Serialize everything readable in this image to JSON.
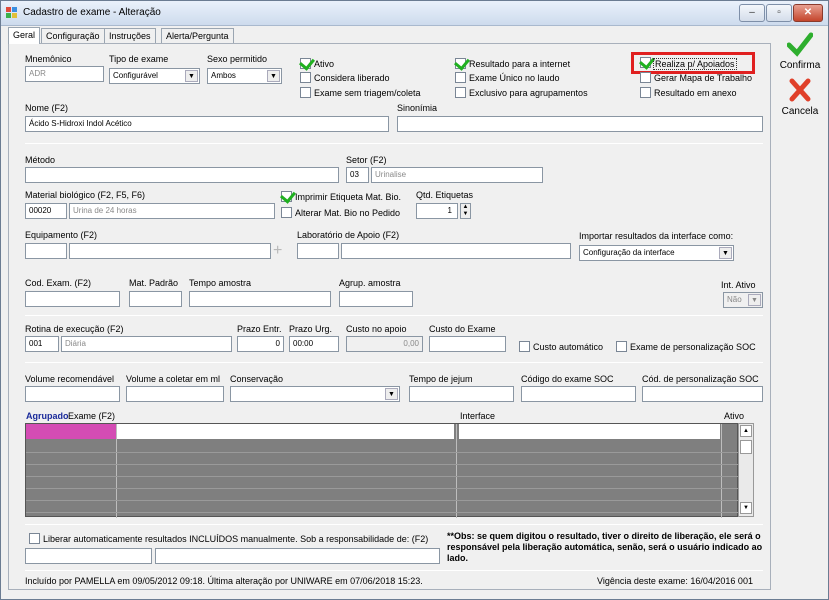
{
  "window": {
    "title": "Cadastro de exame - Alteração",
    "minimize": "–",
    "maximize": "▫",
    "close": "✕"
  },
  "tabs": [
    "Geral",
    "Configuração",
    "Instruções",
    "Alerta/Pergunta"
  ],
  "actions": {
    "confirm": "Confirma",
    "cancel": "Cancela"
  },
  "fields": {
    "mnemonico_label": "Mnemônico",
    "mnemonico_value": "ADR",
    "tipo_label": "Tipo de exame",
    "tipo_value": "Configurável",
    "sexo_label": "Sexo permitido",
    "sexo_value": "Ambos",
    "nome_label": "Nome (F2)",
    "nome_value": "Ácido S-Hidroxi Indol Acético",
    "sinonimia_label": "Sinonímia",
    "metodo_label": "Método",
    "setor_label": "Setor (F2)",
    "setor_code": "03",
    "setor_name": "Urinalise",
    "material_label": "Material biológico (F2, F5, F6)",
    "material_code": "00020",
    "material_name": "Urina de 24 horas",
    "qtd_label": "Qtd. Etiquetas",
    "qtd_value": "1",
    "equip_label": "Equipamento (F2)",
    "lab_label": "Laboratório de Apoio (F2)",
    "importar_label": "Importar resultados da interface como:",
    "importar_value": "Configuração da interface",
    "cod_exam_label": "Cod. Exam. (F2)",
    "mat_padrao_label": "Mat. Padrão",
    "tempo_amostra_label": "Tempo amostra",
    "agrup_amostra_label": "Agrup. amostra",
    "int_ativo_label": "Int. Ativo",
    "int_ativo_value": "Não",
    "rotina_label": "Rotina de execução (F2)",
    "rotina_code": "001",
    "rotina_name": "Diária",
    "prazo_entr_label": "Prazo Entr.",
    "prazo_entr_value": "0",
    "prazo_urg_label": "Prazo Urg.",
    "prazo_urg_value": "00:00",
    "custo_apoio_label": "Custo no apoio",
    "custo_apoio_value": "0,00",
    "custo_exame_label": "Custo do Exame",
    "vol_rec_label": "Volume recomendável",
    "vol_col_label": "Volume a coletar em ml",
    "conservacao_label": "Conservação",
    "jejum_label": "Tempo de jejum",
    "cod_soc_label": "Código do exame SOC",
    "cod_pers_soc_label": "Cód. de personalização SOC"
  },
  "checkboxes": {
    "ativo": "Ativo",
    "considera_liberado": "Considera liberado",
    "sem_triagem": "Exame sem triagem/coleta",
    "resultado_internet": "Resultado para a internet",
    "exame_unico": "Exame Único no laudo",
    "exclusivo_agrup": "Exclusivo para agrupamentos",
    "realiza_apoiados": "Realiza p/ Apoiados",
    "gerar_mapa": "Gerar Mapa de Trabalho",
    "resultado_anexo": "Resultado em anexo",
    "imprimir_etiqueta": "Imprimir Etiqueta Mat. Bio.",
    "alterar_mat": "Alterar Mat. Bio no Pedido",
    "custo_auto": "Custo automático",
    "exame_pers_soc": "Exame de personalização SOC",
    "liberar_auto": "Liberar automaticamente resultados INCLUÍDOS manualmente. Sob a responsabilidade de: (F2)"
  },
  "grid": {
    "col_agrupado": "Agrupado",
    "col_exame": "Exame (F2)",
    "col_interface": "Interface",
    "col_ativo": "Ativo"
  },
  "obs": "**Obs: se quem digitou o resultado, tiver o direito de liberação, ele será o responsável pela liberação automática, senão, será o usuário indicado ao lado.",
  "status": {
    "inclusao": "Incluído por PAMELLA em 09/05/2012 09:18. Última alteração por UNIWARE em 07/06/2018 15:23.",
    "vigencia": "Vigência deste exame: 16/04/2016 001"
  },
  "colors": {
    "accent": "#e02020",
    "grid_selected": "#d44cb4",
    "confirm": "#2eae2e",
    "cancel": "#e0402a"
  }
}
